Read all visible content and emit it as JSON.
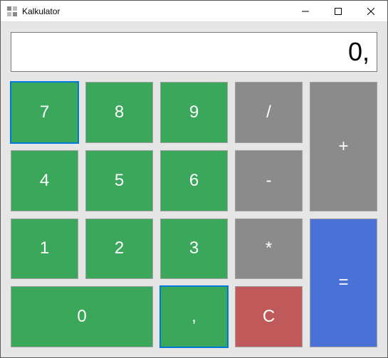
{
  "window": {
    "title": "Kalkulator"
  },
  "display": {
    "value": "0,"
  },
  "buttons": {
    "n7": "7",
    "n8": "8",
    "n9": "9",
    "n4": "4",
    "n5": "5",
    "n6": "6",
    "n1": "1",
    "n2": "2",
    "n3": "3",
    "n0": "0",
    "divide": "/",
    "minus": "-",
    "multiply": "*",
    "plus": "+",
    "equals": "=",
    "comma": ",",
    "clear": "C"
  },
  "colors": {
    "green": "#3aa75a",
    "gray": "#8b8b8b",
    "blue": "#4a72d6",
    "red": "#c05a5a"
  }
}
